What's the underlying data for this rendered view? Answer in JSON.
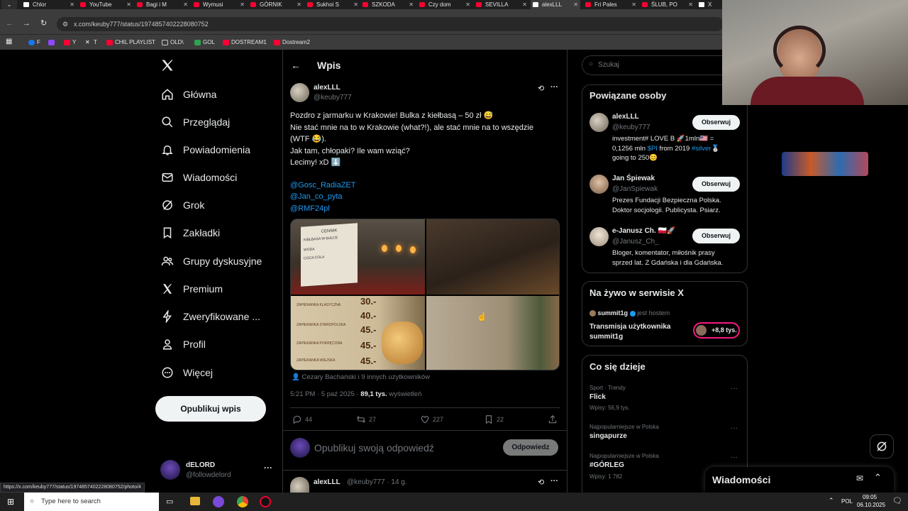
{
  "browser": {
    "tabs": [
      {
        "label": "Chlor"
      },
      {
        "label": "YouTube"
      },
      {
        "label": "Bagi i M"
      },
      {
        "label": "Wymusi"
      },
      {
        "label": "GÓRNIK"
      },
      {
        "label": "Sukhoi S"
      },
      {
        "label": "SZKODA"
      },
      {
        "label": "Czy dom"
      },
      {
        "label": "SEVILLA"
      },
      {
        "label": "alexLLL"
      },
      {
        "label": "Fri Pales"
      },
      {
        "label": "ŚLUB, PO"
      },
      {
        "label": "X"
      }
    ],
    "url": "x.com/keuby777/status/1974857402228080752",
    "bookmarks": [
      {
        "label": "F"
      },
      {
        "label": "Y"
      },
      {
        "label": "T"
      },
      {
        "label": "CHIL PLAYLIST"
      },
      {
        "label": "OLD\\"
      },
      {
        "label": "GOL"
      },
      {
        "label": "DOSTREAM1"
      },
      {
        "label": "Dostream2"
      }
    ],
    "status_url": "https://x.com/keuby777/status/1974857402228080752/photo/4"
  },
  "nav": {
    "items": [
      {
        "label": "Główna",
        "icon": "home-icon"
      },
      {
        "label": "Przeglądaj",
        "icon": "search-icon"
      },
      {
        "label": "Powiadomienia",
        "icon": "bell-icon"
      },
      {
        "label": "Wiadomości",
        "icon": "mail-icon"
      },
      {
        "label": "Grok",
        "icon": "grok-icon"
      },
      {
        "label": "Zakładki",
        "icon": "bookmark-icon"
      },
      {
        "label": "Grupy dyskusyjne",
        "icon": "people-icon"
      },
      {
        "label": "Premium",
        "icon": "x-icon"
      },
      {
        "label": "Zweryfikowane ...",
        "icon": "bolt-icon"
      },
      {
        "label": "Profil",
        "icon": "person-icon"
      },
      {
        "label": "Więcej",
        "icon": "more-icon"
      }
    ],
    "post_button": "Opublikuj wpis",
    "account": {
      "name": "dELORD",
      "handle": "@followdelord"
    }
  },
  "post": {
    "header_title": "Wpis",
    "author_name": "alexLLL",
    "author_handle": "@keuby777",
    "lines": [
      "Pozdro z jarmarku w Krakowie! Bulka z kiełbasą – 50 zł 😅",
      "Nie stać mnie na to w Krakowie (what?!), ale stać mnie na to wszędzie",
      "(WTF 😂).",
      "Jak tam, chłopaki? Ile wam wziąć?",
      "Lecimy! xD ⬇️"
    ],
    "mentions": [
      "@Gosc_RadiaZET",
      "@Jan_co_pyta",
      "@RMF24pl"
    ],
    "tagged": "Cezary Bachański i 9 innych użytkowników",
    "time": "5:21 PM · 5 paź 2025 · ",
    "views_count": "89,1 tys.",
    "views_label": " wyświetleń",
    "stats": {
      "replies": "44",
      "reposts": "27",
      "likes": "227",
      "bookmarks": "22"
    },
    "reply_placeholder": "Opublikuj swoją odpowiedź",
    "reply_button": "Odpowiedz",
    "photo_text": {
      "sign1": "CENNIK",
      "sign2": "KIEŁBASA W BUŁCE",
      "sign3": "WODA",
      "sign4": "COCA COLA",
      "price1": "30.-",
      "price2": "40.-",
      "price3": "45.-",
      "price4": "45.-",
      "price5": "45.-",
      "menu1": "ZAPIEKANKA KLASYCZNA",
      "menu2": "ZAPIEKANKA STAROPOLSKA",
      "menu3": "ZAPIEKANKA POKRĘCONA",
      "menu4": "ZAPIEKANKA WIEJSKA"
    }
  },
  "reply": {
    "author_name": "alexLLL",
    "meta": "@keuby777 · 14 g."
  },
  "right": {
    "search_placeholder": "Szukaj",
    "related_title": "Powiązane osoby",
    "follow_label": "Obserwuj",
    "people": [
      {
        "name": "alexLLL",
        "handle": "@keuby777",
        "bio_a": "investment# LOVE B 🚀1mln🇺🇸 =",
        "bio_b_pre": "0,1256 mln ",
        "bio_b_tag1": "$PI",
        "bio_b_mid": " from 2019 ",
        "bio_b_tag2": "#silver",
        "bio_b_end": "🥈",
        "bio_c": "going to 250😊"
      },
      {
        "name": "Jan Śpiewak",
        "handle": "@JanSpiewak",
        "bio_a": "Prezes Fundacji Bezpieczna Polska.",
        "bio_b": "Doktor socjologii. Publicysta. Psiarz."
      },
      {
        "name": "e-Janusz Ch. 🇵🇱🚀",
        "handle": "@Janusz_Ch_",
        "bio_a": "Bloger, komentator, miłośnik prasy",
        "bio_b": "sprzed lat. Z Gdańska i dla Gdańska."
      }
    ],
    "live_title": "Na żywo w serwisie X",
    "live_host": "summit1g",
    "live_host_suffix": "jest hostem",
    "live_name_a": "Transmisja użytkownika",
    "live_name_b": "summit1g",
    "live_count": "+8,8 tys.",
    "trends_title": "Co się dzieje",
    "trends": [
      {
        "context": "Sport · Trendy",
        "name": "Flick",
        "count": "Wpisy: 56,9 tys."
      },
      {
        "context": "Najpopularniejsze w Polska",
        "name": "singapurze",
        "count": ""
      },
      {
        "context": "Najpopularniejsze w Polska",
        "name": "#GÓRLEG",
        "count": "Wpisy: 1 782"
      }
    ],
    "messages_label": "Wiadomości"
  },
  "taskbar": {
    "search_placeholder": "Type here to search",
    "lang": "POL",
    "time": "09:05",
    "date": "06.10.2025"
  },
  "colors": {
    "accent": "#1d9bf0",
    "background": "#000000",
    "border": "#2f3336",
    "muted": "#71767b",
    "live": "#f91880"
  }
}
